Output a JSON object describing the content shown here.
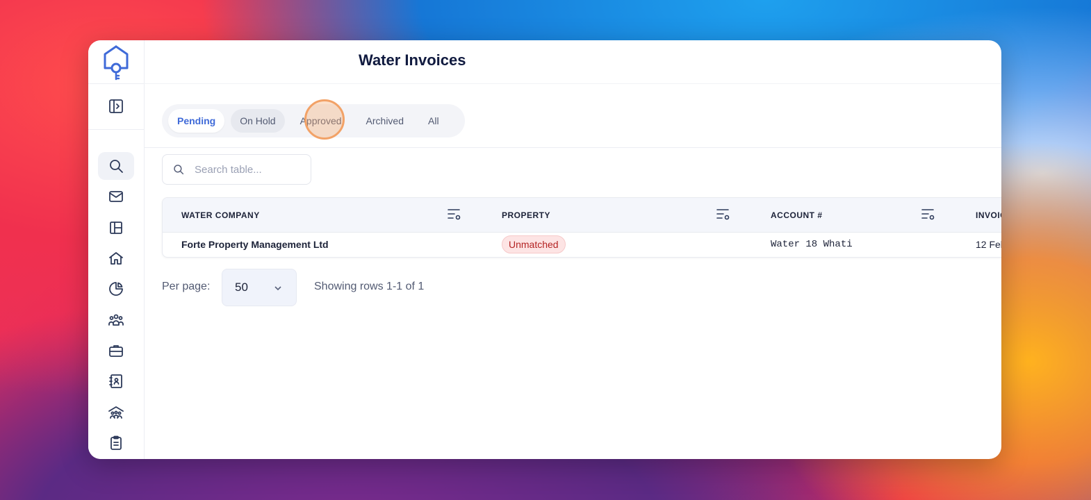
{
  "page": {
    "title": "Water Invoices"
  },
  "tabs": [
    {
      "label": "Pending",
      "active": true
    },
    {
      "label": "On Hold",
      "active": false
    },
    {
      "label": "Approved",
      "active": false
    },
    {
      "label": "Archived",
      "active": false
    },
    {
      "label": "All",
      "active": false
    }
  ],
  "search": {
    "placeholder": "Search table...",
    "value": ""
  },
  "table": {
    "columns": [
      "WATER COMPANY",
      "PROPERTY",
      "ACCOUNT #",
      "INVOIC"
    ],
    "rows": [
      {
        "water_company": "Forte Property Management Ltd",
        "property": "Unmatched",
        "account": "Water 18 Whati",
        "invoice": "12 Feb"
      }
    ]
  },
  "pagination": {
    "per_page_label": "Per page:",
    "per_page_value": "50",
    "showing": "Showing rows 1-1 of 1"
  },
  "sidebar": {
    "icons": [
      "panel-toggle-icon",
      "search-icon",
      "mail-icon",
      "layout-icon",
      "home-icon",
      "pie-chart-icon",
      "users-icon",
      "briefcase-icon",
      "contacts-book-icon",
      "community-icon",
      "clipboard-icon"
    ]
  },
  "colors": {
    "accent": "#3f6ad8",
    "badge_bg": "#fde4e4",
    "badge_text": "#b42323",
    "title": "#101a3f"
  }
}
